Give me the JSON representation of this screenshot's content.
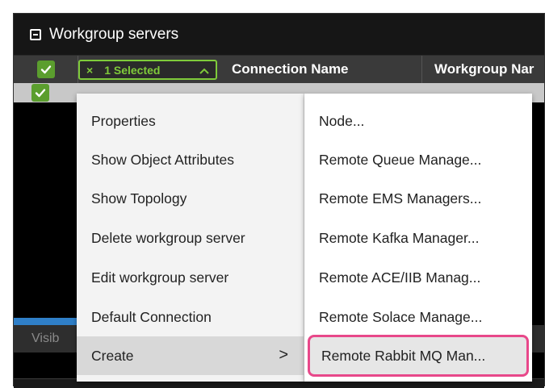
{
  "panel": {
    "title": "Workgroup servers"
  },
  "table": {
    "selection_chip": {
      "close_glyph": "×",
      "label": "1 Selected",
      "caret_glyph": "^"
    },
    "columns": [
      "Connection Name",
      "Workgroup Nar"
    ]
  },
  "footer": {
    "visible_text": "Visib"
  },
  "context_menu": {
    "items": [
      {
        "label": "Properties"
      },
      {
        "label": "Show Object Attributes"
      },
      {
        "label": "Show Topology"
      },
      {
        "label": "Delete workgroup server"
      },
      {
        "label": "Edit workgroup server"
      },
      {
        "label": "Default Connection"
      },
      {
        "label": "Create",
        "arrow": ">"
      }
    ]
  },
  "submenu": {
    "items": [
      {
        "label": "Node..."
      },
      {
        "label": "Remote Queue Manage..."
      },
      {
        "label": "Remote EMS Managers..."
      },
      {
        "label": "Remote Kafka Manager..."
      },
      {
        "label": "Remote ACE/IIB Manag..."
      },
      {
        "label": "Remote Solace Manage..."
      },
      {
        "label": "Remote Rabbit MQ Man..."
      }
    ]
  },
  "colors": {
    "accent_green": "#7fcb3a",
    "checkbox_green": "#5b9e2e",
    "highlight_pink": "#e8488a",
    "selection_blue": "#2f7fc8"
  },
  "icons": {
    "collapse": "collapse-square-icon",
    "check": "checkmark-icon",
    "close": "close-icon",
    "caret_up": "chevron-up-icon",
    "submenu_arrow": "chevron-right-icon"
  }
}
